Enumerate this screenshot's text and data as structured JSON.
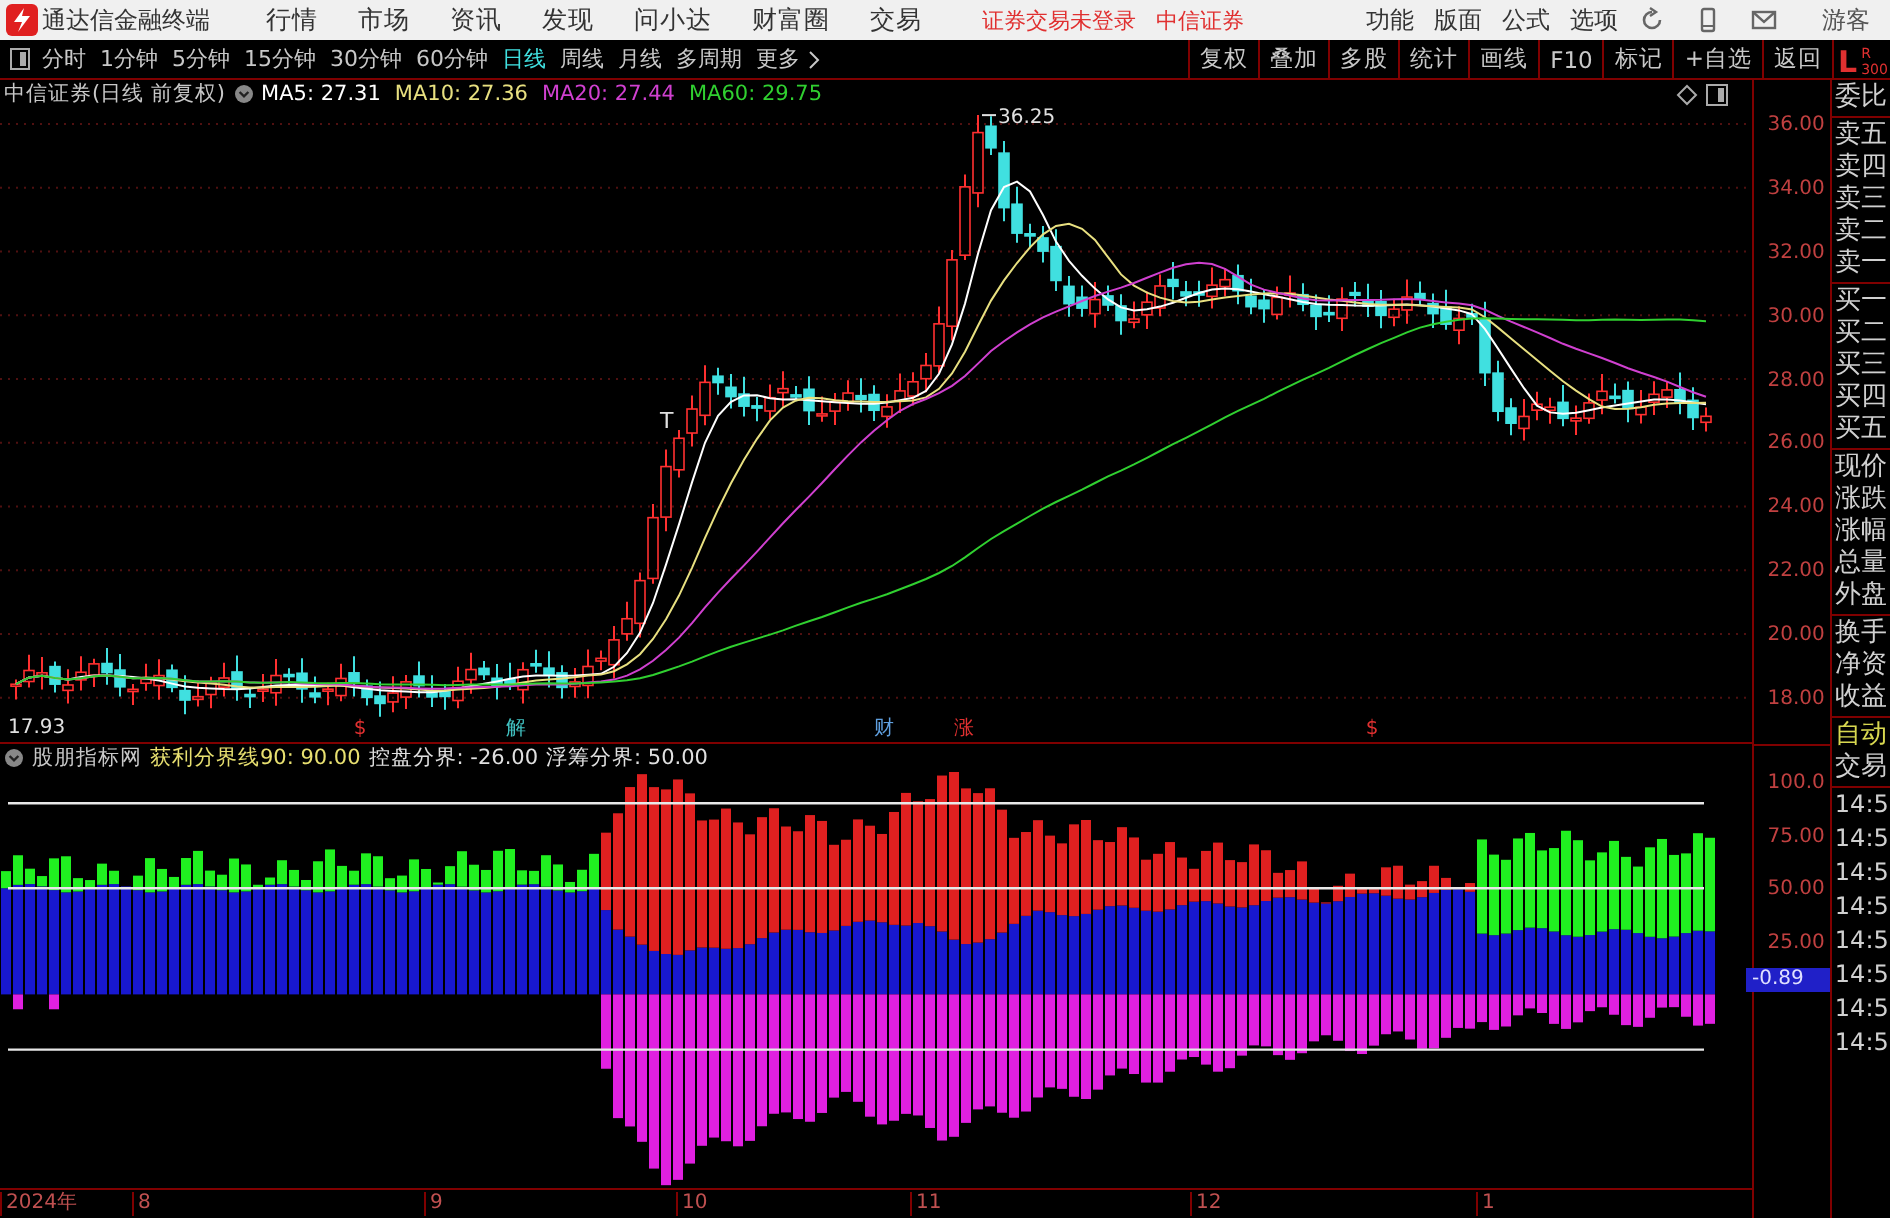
{
  "app_title": "通达信金融终端",
  "menu": [
    "行情",
    "市场",
    "资讯",
    "发现",
    "问小达",
    "财富圈",
    "交易"
  ],
  "login_status": "证券交易未登录",
  "broker": "中信证券",
  "top_menu": [
    "功能",
    "版面",
    "公式",
    "选项"
  ],
  "user": "游客",
  "periods": [
    {
      "label": "分时",
      "selected": false
    },
    {
      "label": "1分钟",
      "selected": false
    },
    {
      "label": "5分钟",
      "selected": false
    },
    {
      "label": "15分钟",
      "selected": false
    },
    {
      "label": "30分钟",
      "selected": false
    },
    {
      "label": "60分钟",
      "selected": false
    },
    {
      "label": "日线",
      "selected": true
    },
    {
      "label": "周线",
      "selected": false
    },
    {
      "label": "月线",
      "selected": false
    },
    {
      "label": "多周期",
      "selected": false
    },
    {
      "label": "更多",
      "selected": false
    }
  ],
  "tools": [
    "复权",
    "叠加",
    "多股",
    "统计",
    "画线",
    "F10",
    "标记",
    "+自选",
    "返回"
  ],
  "side_header": {
    "left": "L",
    "right": "R",
    "sub": "300"
  },
  "chart": {
    "title": "中信证券(日线 前复权)",
    "ma": [
      {
        "label": "MA5: 27.31",
        "color": "#ffffff"
      },
      {
        "label": "MA10: 27.36",
        "color": "#e8e080"
      },
      {
        "label": "MA20: 27.44",
        "color": "#d040d0"
      },
      {
        "label": "MA60: 29.75",
        "color": "#30d030"
      }
    ],
    "high_label": "36.25",
    "low_label": "17.93",
    "mark": "T",
    "events": [
      {
        "label": "$",
        "color": "#e03030"
      },
      {
        "label": "解",
        "color": "#40c0c0"
      },
      {
        "label": "财",
        "color": "#60a0e0"
      },
      {
        "label": "涨",
        "color": "#e03030"
      },
      {
        "label": "$",
        "color": "#e03030"
      }
    ]
  },
  "price_axis": [
    "36.00",
    "34.00",
    "32.00",
    "30.00",
    "28.00",
    "26.00",
    "24.00",
    "22.00",
    "20.00",
    "18.00"
  ],
  "indicator": {
    "name": "股朋指标网",
    "params": [
      {
        "label": "获利分界线90: 90.00",
        "color": "#e8e070"
      },
      {
        "label": "控盘分界: -26.00",
        "color": "#e0e0e0"
      },
      {
        "label": "浮筹分界: 50.00",
        "color": "#e0e0e0"
      }
    ]
  },
  "indicator_axis": [
    "100.0",
    "75.00",
    "50.00",
    "25.00"
  ],
  "current_value": "-0.89",
  "date_axis": [
    "2024年",
    "8",
    "9",
    "10",
    "11",
    "12",
    "1"
  ],
  "side_groups": [
    [
      "委比"
    ],
    [
      "卖五",
      "卖四",
      "卖三",
      "卖二",
      "卖一"
    ],
    [
      "买一",
      "买二",
      "买三",
      "买四",
      "买五"
    ],
    [
      "现价",
      "涨跌",
      "涨幅",
      "总量",
      "外盘"
    ],
    [
      "换手",
      "净资",
      "收益"
    ]
  ],
  "side_modes": [
    {
      "label": "自动",
      "highlighted": true
    },
    {
      "label": "交易",
      "highlighted": false
    }
  ],
  "times": [
    "14:5",
    "14:5",
    "14:5",
    "14:5",
    "14:5",
    "14:5",
    "14:5",
    "14:5"
  ]
}
